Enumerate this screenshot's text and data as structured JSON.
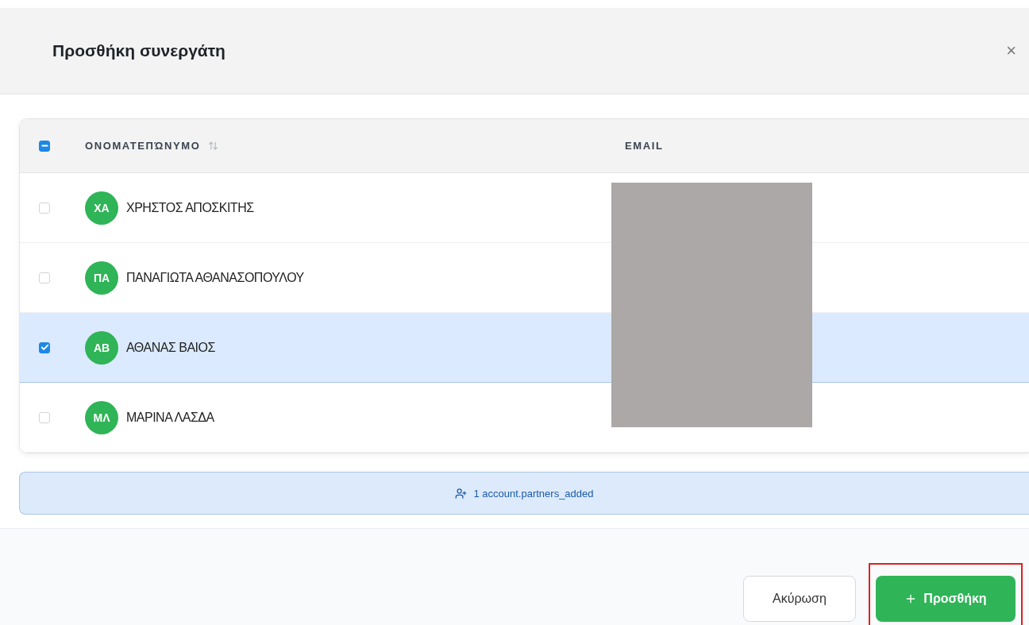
{
  "dialog": {
    "title": "Προσθήκη συνεργάτη",
    "close_label": "×"
  },
  "table": {
    "select_all": {
      "indeterminate": true
    },
    "columns": [
      {
        "label": "ΟΝΟΜΑΤΕΠΏΝΥΜΟ",
        "sortable": true
      },
      {
        "label": "EMAIL",
        "sortable": false
      }
    ],
    "email_redacted": true,
    "rows": [
      {
        "initials": "ΧΑ",
        "name": "ΧΡΗΣΤΟΣ ΑΠΟΣΚΙΤΗΣ",
        "selected": false
      },
      {
        "initials": "ΠΑ",
        "name": "ΠΑΝΑΓΙΩΤΑ ΑΘΑΝΑΣΟΠΟΥΛΟΥ",
        "selected": false
      },
      {
        "initials": "ΑΒ",
        "name": "ΑΘΑΝΑΣ ΒΑΙΟΣ",
        "selected": true
      },
      {
        "initials": "ΜΛ",
        "name": "ΜΑΡΙΝΑ ΛΑΣΔΑ",
        "selected": false
      }
    ]
  },
  "banner": {
    "text": "1 account.partners_added"
  },
  "footer": {
    "buttons": [
      {
        "label": "Ακύρωση",
        "kind": "secondary",
        "highlighted": false
      },
      {
        "label": "Προσθήκη",
        "kind": "primary",
        "highlighted": true
      }
    ]
  }
}
